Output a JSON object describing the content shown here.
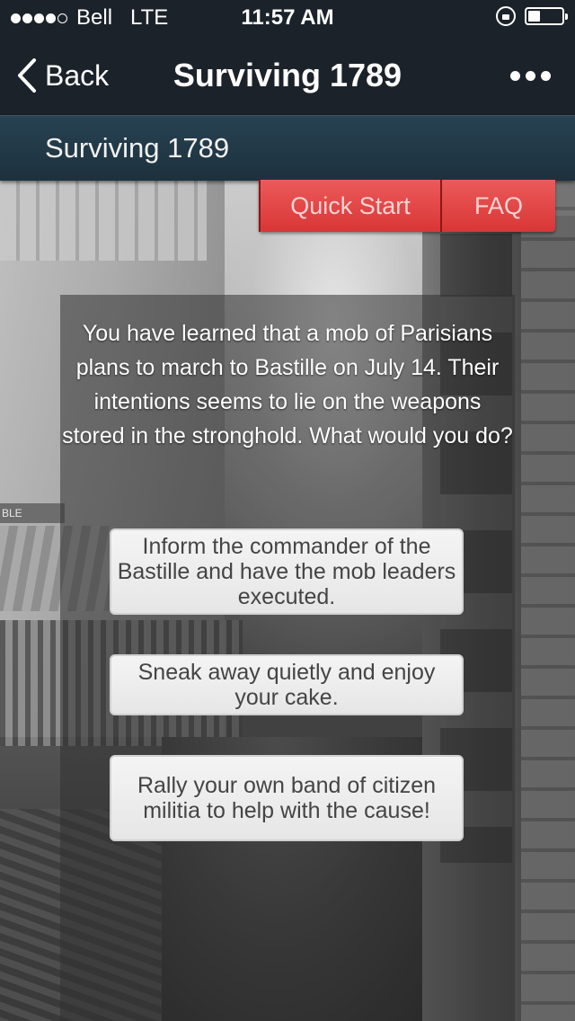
{
  "status_bar": {
    "carrier": "Bell",
    "network": "LTE",
    "time": "11:57 AM",
    "signal_bars_filled": 4,
    "signal_bars_total": 5,
    "battery_level": 0.35
  },
  "nav": {
    "back_label": "Back",
    "title": "Surviving 1789",
    "more_icon": "more-dots-icon"
  },
  "sub_header": {
    "title": "Surviving 1789"
  },
  "tabs": {
    "quick_start_label": "Quick Start",
    "faq_label": "FAQ"
  },
  "story": {
    "prompt": "You have learned that a mob of Parisians plans to march to Bastille on July 14. Their intentions seems to lie on the weapons stored in the stronghold. What would you do?",
    "choices": [
      {
        "label": "Inform the commander of the Bastille and have the mob leaders executed."
      },
      {
        "label": "Sneak away quietly and enjoy your cake."
      },
      {
        "label": "Rally your own band of citizen militia to help with the cause!"
      }
    ]
  },
  "background": {
    "shop_sign": "BLE"
  },
  "colors": {
    "nav_bg": "#1c2229",
    "sub_header_bg": "#274252",
    "accent_red": "#d93636",
    "choice_bg": "#eeeeee"
  }
}
